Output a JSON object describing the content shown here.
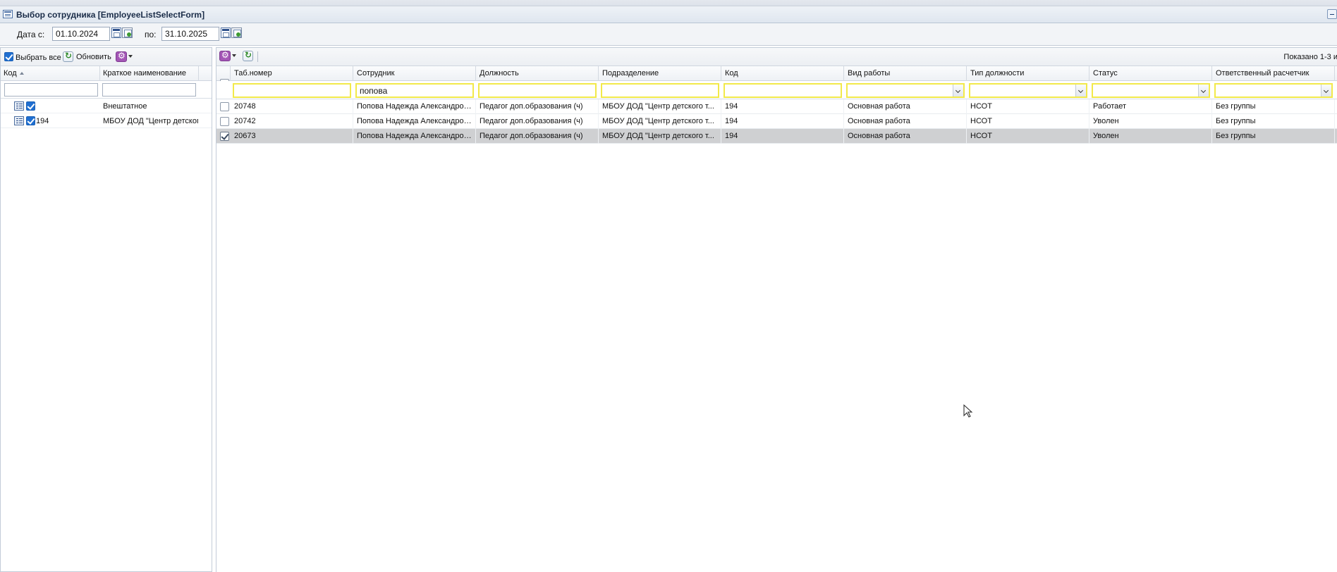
{
  "window": {
    "title": "Выбор сотрудника [EmployeeListSelectForm]",
    "icon": "form-icon",
    "minimize_icon": "minimize-icon"
  },
  "date_filter": {
    "from_label": "Дата с:",
    "from_value": "01.10.2024",
    "to_label": "по:",
    "to_value": "31.10.2025"
  },
  "left": {
    "select_all_label": "Выбрать все",
    "select_all_checked": true,
    "refresh_label": "Обновить",
    "columns": [
      "Код",
      "Краткое наименование"
    ],
    "rows": [
      {
        "code": "",
        "name": "Внештатное",
        "checked": true
      },
      {
        "code": "194",
        "name": "МБОУ ДОД \"Центр детског",
        "checked": true
      }
    ]
  },
  "grid": {
    "shown_text": "Показано 1-3 и",
    "columns": [
      "Таб.номер",
      "Сотрудник",
      "Должность",
      "Подразделение",
      "Код",
      "Вид работы",
      "Тип должности",
      "Статус",
      "Ответственный расчетчик"
    ],
    "filters": {
      "tab": "",
      "employee": "попова",
      "position": "",
      "dept": "",
      "code": ""
    },
    "rows": [
      {
        "checked": false,
        "selected": false,
        "cells": [
          "20748",
          "Попова Надежда Александров...",
          "Педагог доп.образования (ч)",
          "МБОУ ДОД \"Центр детского т...",
          "194",
          "Основная работа",
          "НСОТ",
          "Работает",
          "Без группы"
        ]
      },
      {
        "checked": false,
        "selected": false,
        "cells": [
          "20742",
          "Попова Надежда Александров...",
          "Педагог доп.образования (ч)",
          "МБОУ ДОД \"Центр детского т...",
          "194",
          "Основная работа",
          "НСОТ",
          "Уволен",
          "Без группы"
        ]
      },
      {
        "checked": true,
        "selected": true,
        "cells": [
          "20673",
          "Попова Надежда Александров...",
          "Педагог доп.образования (ч)",
          "МБОУ ДОД \"Центр детского т...",
          "194",
          "Основная работа",
          "НСОТ",
          "Уволен",
          "Без группы"
        ]
      }
    ]
  }
}
